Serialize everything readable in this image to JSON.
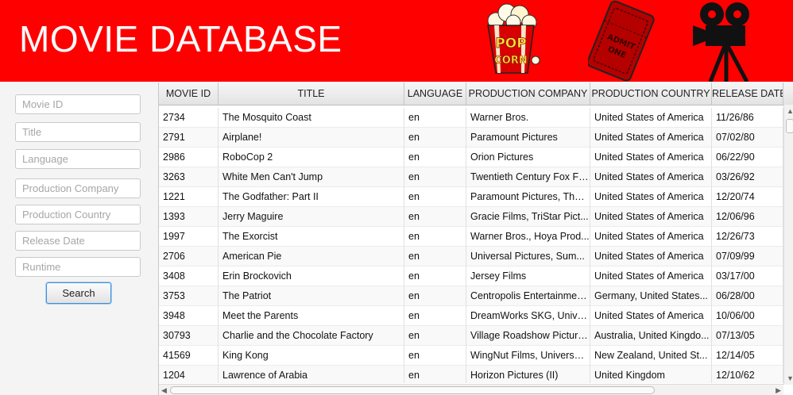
{
  "header": {
    "title": "MOVIE DATABASE"
  },
  "images": [
    "popcorn-icon",
    "ticket-icon",
    "film-camera-icon"
  ],
  "popcorn_text": {
    "line1": "POP",
    "line2": "CORN"
  },
  "ticket_text": {
    "line1": "ADMIT",
    "line2": "ONE"
  },
  "search": {
    "movie_id_placeholder": "Movie ID",
    "title_placeholder": "Title",
    "language_placeholder": "Language",
    "company_placeholder": "Production Company",
    "country_placeholder": "Production Country",
    "release_placeholder": "Release Date",
    "runtime_placeholder": "Runtime",
    "button_label": "Search"
  },
  "colors": {
    "header_bg": "#fe0000",
    "title_text": "#ffffff",
    "button_focus": "#3c8fd6"
  },
  "table": {
    "columns": [
      "MOVIE ID",
      "TITLE",
      "LANGUAGE",
      "PRODUCTION COMPANY",
      "PRODUCTION COUNTRY",
      "RELEASE DATE"
    ],
    "rows": [
      [
        "2734",
        "The Mosquito Coast",
        "en",
        "Warner Bros.",
        "United States of America",
        "11/26/86"
      ],
      [
        "2791",
        "Airplane!",
        "en",
        "Paramount Pictures",
        "United States of America",
        "07/02/80"
      ],
      [
        "2986",
        "RoboCop 2",
        "en",
        "Orion Pictures",
        "United States of America",
        "06/22/90"
      ],
      [
        "3263",
        "White Men Can't Jump",
        "en",
        "Twentieth Century Fox Fil...",
        "United States of America",
        "03/26/92"
      ],
      [
        "1221",
        "The Godfather: Part II",
        "en",
        "Paramount Pictures, The ...",
        "United States of America",
        "12/20/74"
      ],
      [
        "1393",
        "Jerry Maguire",
        "en",
        "Gracie Films, TriStar Pict...",
        "United States of America",
        "12/06/96"
      ],
      [
        "1997",
        "The Exorcist",
        "en",
        "Warner Bros., Hoya Prod...",
        "United States of America",
        "12/26/73"
      ],
      [
        "2706",
        "American Pie",
        "en",
        "Universal Pictures, Sum...",
        "United States of America",
        "07/09/99"
      ],
      [
        "3408",
        "Erin Brockovich",
        "en",
        "Jersey Films",
        "United States of America",
        "03/17/00"
      ],
      [
        "3753",
        "The Patriot",
        "en",
        "Centropolis Entertainmen...",
        "Germany, United States...",
        "06/28/00"
      ],
      [
        "3948",
        "Meet the Parents",
        "en",
        "DreamWorks SKG, Unive...",
        "United States of America",
        "10/06/00"
      ],
      [
        "30793",
        "Charlie and the Chocolate Factory",
        "en",
        "Village Roadshow Picture...",
        "Australia, United Kingdo...",
        "07/13/05"
      ],
      [
        "41569",
        "King Kong",
        "en",
        "WingNut Films, Universal...",
        "New Zealand, United St...",
        "12/14/05"
      ],
      [
        "1204",
        "Lawrence of Arabia",
        "en",
        "Horizon Pictures (II)",
        "United Kingdom",
        "12/10/62"
      ]
    ]
  }
}
